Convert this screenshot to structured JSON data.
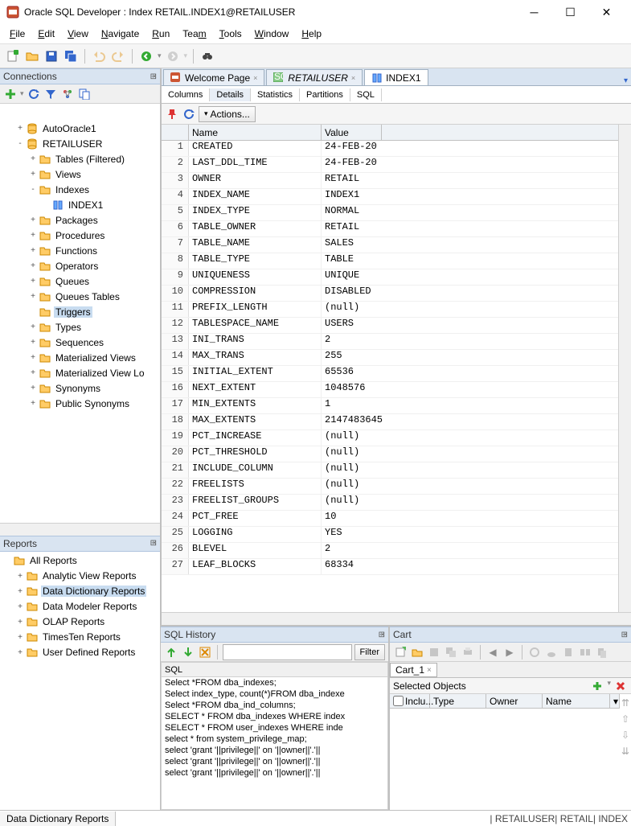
{
  "window": {
    "title": "Oracle SQL Developer : Index RETAIL.INDEX1@RETAILUSER"
  },
  "menu": {
    "file": "File",
    "edit": "Edit",
    "view": "View",
    "navigate": "Navigate",
    "run": "Run",
    "team": "Team",
    "tools": "Tools",
    "window": "Window",
    "help": "Help"
  },
  "connections": {
    "title": "Connections",
    "items": [
      {
        "label": "AutoOracle1",
        "depth": 1,
        "exp": "+",
        "icon": "db"
      },
      {
        "label": "RETAILUSER",
        "depth": 1,
        "exp": "-",
        "icon": "db"
      },
      {
        "label": "Tables (Filtered)",
        "depth": 2,
        "exp": "+",
        "icon": "folder"
      },
      {
        "label": "Views",
        "depth": 2,
        "exp": "+",
        "icon": "folder"
      },
      {
        "label": "Indexes",
        "depth": 2,
        "exp": "-",
        "icon": "folder"
      },
      {
        "label": "INDEX1",
        "depth": 3,
        "exp": "",
        "icon": "index"
      },
      {
        "label": "Packages",
        "depth": 2,
        "exp": "+",
        "icon": "folder"
      },
      {
        "label": "Procedures",
        "depth": 2,
        "exp": "+",
        "icon": "folder"
      },
      {
        "label": "Functions",
        "depth": 2,
        "exp": "+",
        "icon": "folder"
      },
      {
        "label": "Operators",
        "depth": 2,
        "exp": "+",
        "icon": "folder"
      },
      {
        "label": "Queues",
        "depth": 2,
        "exp": "+",
        "icon": "folder"
      },
      {
        "label": "Queues Tables",
        "depth": 2,
        "exp": "+",
        "icon": "folder"
      },
      {
        "label": "Triggers",
        "depth": 2,
        "exp": "",
        "icon": "folder",
        "selected": true
      },
      {
        "label": "Types",
        "depth": 2,
        "exp": "+",
        "icon": "folder"
      },
      {
        "label": "Sequences",
        "depth": 2,
        "exp": "+",
        "icon": "folder"
      },
      {
        "label": "Materialized Views",
        "depth": 2,
        "exp": "+",
        "icon": "folder"
      },
      {
        "label": "Materialized View Lo",
        "depth": 2,
        "exp": "+",
        "icon": "folder"
      },
      {
        "label": "Synonyms",
        "depth": 2,
        "exp": "+",
        "icon": "folder"
      },
      {
        "label": "Public Synonyms",
        "depth": 2,
        "exp": "+",
        "icon": "folder"
      }
    ]
  },
  "reports": {
    "title": "Reports",
    "items": [
      {
        "label": "All Reports",
        "depth": 0,
        "exp": "",
        "icon": "folder"
      },
      {
        "label": "Analytic View Reports",
        "depth": 1,
        "exp": "+",
        "icon": "folder"
      },
      {
        "label": "Data Dictionary Reports",
        "depth": 1,
        "exp": "+",
        "icon": "folder",
        "selected": true
      },
      {
        "label": "Data Modeler Reports",
        "depth": 1,
        "exp": "+",
        "icon": "folder"
      },
      {
        "label": "OLAP Reports",
        "depth": 1,
        "exp": "+",
        "icon": "folder"
      },
      {
        "label": "TimesTen Reports",
        "depth": 1,
        "exp": "+",
        "icon": "folder"
      },
      {
        "label": "User Defined Reports",
        "depth": 1,
        "exp": "+",
        "icon": "folder"
      }
    ]
  },
  "editor": {
    "tabs": [
      {
        "label": "Welcome Page",
        "icon": "oracle",
        "active": false
      },
      {
        "label": "RETAILUSER",
        "icon": "sql",
        "active": false,
        "italic": true
      },
      {
        "label": "INDEX1",
        "icon": "index",
        "active": true
      }
    ],
    "subtabs": [
      "Columns",
      "Details",
      "Statistics",
      "Partitions",
      "SQL"
    ],
    "active_subtab": "Details",
    "actions_label": "Actions...",
    "grid_headers": {
      "name": "Name",
      "value": "Value"
    },
    "rows": [
      {
        "n": 1,
        "name": "CREATED",
        "value": "24-FEB-20"
      },
      {
        "n": 2,
        "name": "LAST_DDL_TIME",
        "value": "24-FEB-20"
      },
      {
        "n": 3,
        "name": "OWNER",
        "value": "RETAIL"
      },
      {
        "n": 4,
        "name": "INDEX_NAME",
        "value": "INDEX1"
      },
      {
        "n": 5,
        "name": "INDEX_TYPE",
        "value": "NORMAL"
      },
      {
        "n": 6,
        "name": "TABLE_OWNER",
        "value": "RETAIL"
      },
      {
        "n": 7,
        "name": "TABLE_NAME",
        "value": "SALES"
      },
      {
        "n": 8,
        "name": "TABLE_TYPE",
        "value": "TABLE"
      },
      {
        "n": 9,
        "name": "UNIQUENESS",
        "value": "UNIQUE"
      },
      {
        "n": 10,
        "name": "COMPRESSION",
        "value": "DISABLED"
      },
      {
        "n": 11,
        "name": "PREFIX_LENGTH",
        "value": "(null)"
      },
      {
        "n": 12,
        "name": "TABLESPACE_NAME",
        "value": "USERS"
      },
      {
        "n": 13,
        "name": "INI_TRANS",
        "value": "2"
      },
      {
        "n": 14,
        "name": "MAX_TRANS",
        "value": "255"
      },
      {
        "n": 15,
        "name": "INITIAL_EXTENT",
        "value": "65536"
      },
      {
        "n": 16,
        "name": "NEXT_EXTENT",
        "value": "1048576"
      },
      {
        "n": 17,
        "name": "MIN_EXTENTS",
        "value": "1"
      },
      {
        "n": 18,
        "name": "MAX_EXTENTS",
        "value": "2147483645"
      },
      {
        "n": 19,
        "name": "PCT_INCREASE",
        "value": "(null)"
      },
      {
        "n": 20,
        "name": "PCT_THRESHOLD",
        "value": "(null)"
      },
      {
        "n": 21,
        "name": "INCLUDE_COLUMN",
        "value": "(null)"
      },
      {
        "n": 22,
        "name": "FREELISTS",
        "value": "(null)"
      },
      {
        "n": 23,
        "name": "FREELIST_GROUPS",
        "value": "(null)"
      },
      {
        "n": 24,
        "name": "PCT_FREE",
        "value": "10"
      },
      {
        "n": 25,
        "name": "LOGGING",
        "value": "YES"
      },
      {
        "n": 26,
        "name": "BLEVEL",
        "value": "2"
      },
      {
        "n": 27,
        "name": "LEAF_BLOCKS",
        "value": "68334"
      }
    ]
  },
  "sql_history": {
    "title": "SQL History",
    "filter_label": "Filter",
    "col": "SQL",
    "rows": [
      "Select *FROM dba_indexes;",
      "Select index_type, count(*)FROM dba_indexe",
      "Select *FROM dba_ind_columns;",
      "SELECT *   FROM dba_indexes  WHERE index",
      "SELECT *   FROM user_indexes  WHERE inde",
      "select * from system_privilege_map;",
      "select 'grant '||privilege||' on '||owner||'.'||",
      "select 'grant '||privilege||' on '||owner||'.'||",
      "select 'grant '||privilege||' on '||owner||'.'||"
    ]
  },
  "cart": {
    "title": "Cart",
    "tab_label": "Cart_1",
    "section": "Selected Objects",
    "cols": [
      "Inclu...",
      "Type",
      "Owner",
      "Name"
    ]
  },
  "statusbar": {
    "tab": "Data Dictionary Reports",
    "info": "| RETAILUSER| RETAIL| INDEX"
  }
}
